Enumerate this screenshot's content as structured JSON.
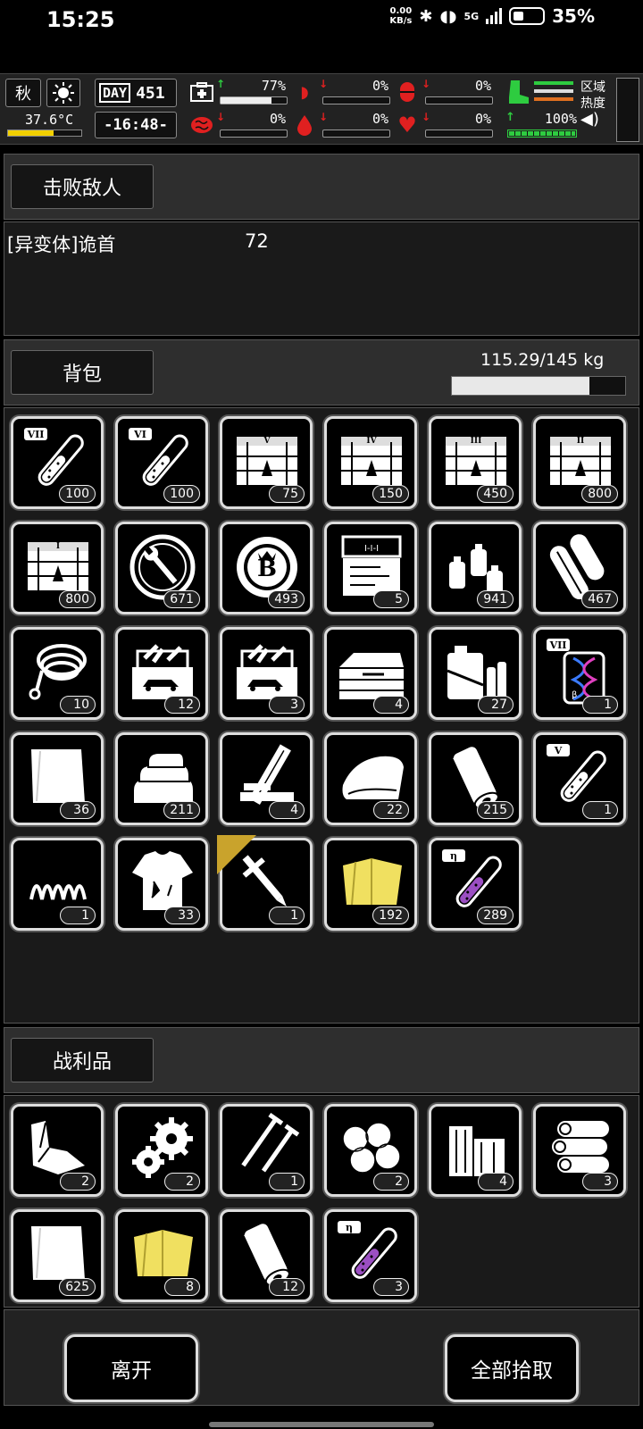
{
  "status_bar": {
    "time": "15:25",
    "net_speed": "0.00",
    "net_unit": "KB/s",
    "signal": "5G",
    "battery": "35%"
  },
  "hud": {
    "season": "秋",
    "temperature": "37.6°C",
    "day_label": "DAY",
    "day_number": "451",
    "clock": "-16:48-",
    "stats": [
      {
        "name": "health",
        "icon": "medkit-icon",
        "arrow": "↑",
        "arrow_color": "#2ecc40",
        "value": "77%",
        "level": 0.77
      },
      {
        "name": "hunger",
        "icon": "stomach-icon",
        "arrow": "↓",
        "arrow_color": "#e02020",
        "value": "0%",
        "level": 0
      },
      {
        "name": "medicine",
        "icon": "pill-icon",
        "arrow": "↓",
        "arrow_color": "#e02020",
        "value": "0%",
        "level": 0
      },
      {
        "name": "mind",
        "icon": "brain-icon",
        "arrow": "↓",
        "arrow_color": "#e02020",
        "value": "0%",
        "level": 0
      },
      {
        "name": "thirst",
        "icon": "water-drop-icon",
        "arrow": "↓",
        "arrow_color": "#e02020",
        "value": "0%",
        "level": 0
      },
      {
        "name": "heart",
        "icon": "heart-icon",
        "arrow": "↓",
        "arrow_color": "#e02020",
        "value": "0%",
        "level": 0
      }
    ],
    "stamina": {
      "arrow": "↑",
      "value": "100%",
      "level": 1.0
    },
    "area_heat_label": "区域热度"
  },
  "defeated": {
    "header": "击败敌人",
    "enemy_name": "[异变体]诡首",
    "enemy_count": "72"
  },
  "backpack": {
    "header": "背包",
    "weight": "115.29/145 kg",
    "weight_ratio": 0.795,
    "items": [
      {
        "icon": "test-tube-vii-icon",
        "count": "100"
      },
      {
        "icon": "test-tube-vi-icon",
        "count": "100"
      },
      {
        "icon": "crate-v-icon",
        "count": "75"
      },
      {
        "icon": "crate-iv-icon",
        "count": "150"
      },
      {
        "icon": "crate-iii-icon",
        "count": "450"
      },
      {
        "icon": "crate-ii-icon",
        "count": "800"
      },
      {
        "icon": "crate-i-icon",
        "count": "800"
      },
      {
        "icon": "wrench-coin-icon",
        "count": "671"
      },
      {
        "icon": "b-coin-icon",
        "count": "493"
      },
      {
        "icon": "toolkit-case-icon",
        "count": "5"
      },
      {
        "icon": "spray-cans-icon",
        "count": "941"
      },
      {
        "icon": "rolled-sheets-icon",
        "count": "467"
      },
      {
        "icon": "rope-icon",
        "count": "10"
      },
      {
        "icon": "car-toolbox-icon",
        "count": "12"
      },
      {
        "icon": "car-toolbox-icon",
        "count": "3"
      },
      {
        "icon": "tool-chest-icon",
        "count": "4"
      },
      {
        "icon": "fuel-supplies-icon",
        "count": "27"
      },
      {
        "icon": "dna-capsule-vii-icon",
        "count": "1"
      },
      {
        "icon": "cloth-sheet-icon",
        "count": "36"
      },
      {
        "icon": "folded-cloth-icon",
        "count": "211"
      },
      {
        "icon": "wood-planks-icon",
        "count": "4"
      },
      {
        "icon": "fabric-icon",
        "count": "22"
      },
      {
        "icon": "paper-roll-icon",
        "count": "215"
      },
      {
        "icon": "test-tube-v-icon",
        "count": "1"
      },
      {
        "icon": "spring-icon",
        "count": "1"
      },
      {
        "icon": "torn-shirt-icon",
        "count": "33"
      },
      {
        "icon": "caliper-knife-icon",
        "count": "1",
        "starred": true
      },
      {
        "icon": "yellow-cloth-icon",
        "count": "192"
      },
      {
        "icon": "purple-tube-eta-icon",
        "count": "289"
      }
    ]
  },
  "loot": {
    "header": "战利品",
    "items": [
      {
        "icon": "scrap-metal-icon",
        "count": "2"
      },
      {
        "icon": "gears-icon",
        "count": "2"
      },
      {
        "icon": "nails-icon",
        "count": "1"
      },
      {
        "icon": "cotton-icon",
        "count": "2"
      },
      {
        "icon": "wood-blocks-icon",
        "count": "4"
      },
      {
        "icon": "logs-icon",
        "count": "3"
      },
      {
        "icon": "cloth-sheet-icon",
        "count": "625"
      },
      {
        "icon": "yellow-cloth-icon",
        "count": "8"
      },
      {
        "icon": "paper-roll-icon",
        "count": "12"
      },
      {
        "icon": "purple-tube-eta-icon",
        "count": "3"
      }
    ]
  },
  "footer": {
    "leave": "离开",
    "take_all": "全部拾取"
  }
}
